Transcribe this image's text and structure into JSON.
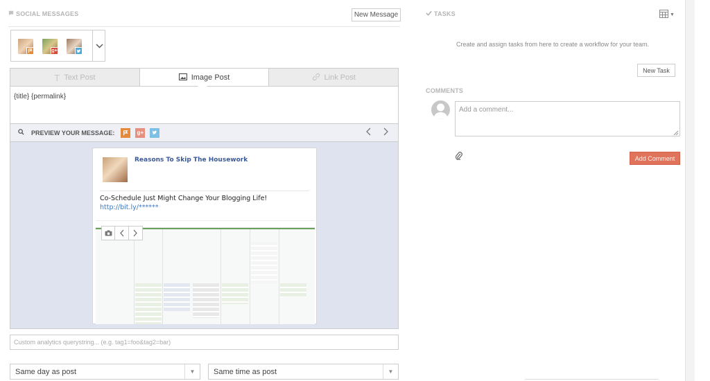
{
  "social": {
    "title": "SOCIAL MESSAGES",
    "new_message_label": "New Message",
    "accounts": [
      {
        "name": "facebook-account",
        "badge": "",
        "color": "#e58a3a"
      },
      {
        "name": "google-plus-account",
        "badge": "g+",
        "color": "#d34836"
      },
      {
        "name": "twitter-account",
        "badge": "",
        "color": "#4fa9d8"
      }
    ],
    "tabs": [
      {
        "label": "Text Post",
        "icon": "T",
        "active": false
      },
      {
        "label": "Image Post",
        "icon": "image-icon",
        "active": true
      },
      {
        "label": "Link Post",
        "icon": "link-icon",
        "active": false
      }
    ],
    "message_text": "{title} {permalink}",
    "preview_label": "PREVIEW YOUR MESSAGE:",
    "card": {
      "title": "Reasons To Skip The Housework",
      "body": "Co-Schedule Just Might Change Your Blogging Life!",
      "link": "http://bit.ly/******"
    },
    "analytics_placeholder": "Custom analytics querystring... (e.g. tag1=foo&tag2=bar)",
    "day_select": "Same day as post",
    "time_select": "Same time as post"
  },
  "tasks": {
    "title": "TASKS",
    "description": "Create and assign tasks from here to create a workflow for your team.",
    "new_task_label": "New Task"
  },
  "comments": {
    "title": "COMMENTS",
    "placeholder": "Add a comment...",
    "add_label": "Add Comment"
  },
  "colors": {
    "facebook": "#e58a3a",
    "google": "#d34836",
    "twitter": "#4fa9d8",
    "accent": "#e0735c",
    "link": "#3b5998"
  }
}
